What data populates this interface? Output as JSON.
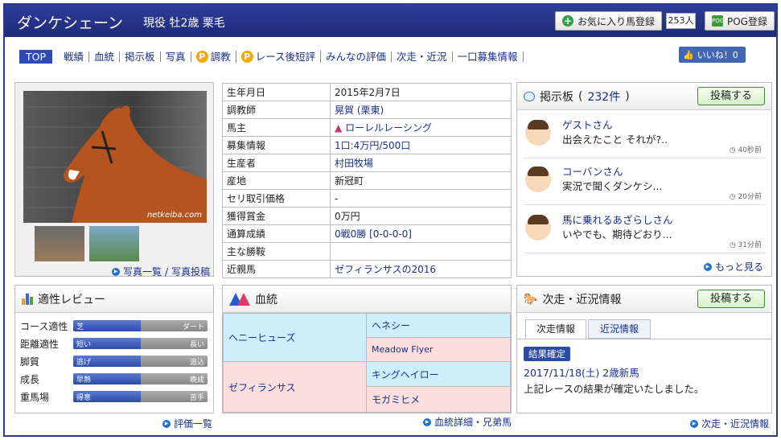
{
  "header": {
    "name": "ダンケシェーン",
    "status": "現役 牡2歳 栗毛",
    "fav_label": "お気に入り馬登録",
    "fav_count": "253人",
    "pog_label": "POG登録",
    "pog_icon": "POG"
  },
  "nav": {
    "top": "TOP",
    "items": [
      "戦績",
      "血統",
      "掲示板",
      "写真",
      "調教",
      "レース後短評",
      "みんなの評価",
      "次走・近況",
      "一口募集情報"
    ],
    "like": "いいね！0"
  },
  "photo": {
    "watermark": "netkeiba.com",
    "link1": "写真一覧",
    "link2": "写真投稿"
  },
  "profile": [
    {
      "k": "生年月日",
      "v": "2015年2月7日"
    },
    {
      "k": "調教師",
      "v": "晃賀 (栗東)"
    },
    {
      "k": "馬主",
      "v": "ローレルレーシング"
    },
    {
      "k": "募集情報",
      "v": "1口:4万円/500口"
    },
    {
      "k": "生産者",
      "v": "村田牧場"
    },
    {
      "k": "産地",
      "v": "新冠町"
    },
    {
      "k": "セリ取引価格",
      "v": "-"
    },
    {
      "k": "獲得賞金",
      "v": "0万円"
    },
    {
      "k": "通算成績",
      "v": "0戦0勝 [0-0-0-0]"
    },
    {
      "k": "主な勝鞍",
      "v": ""
    },
    {
      "k": "近親馬",
      "v": "ゼフィランサスの2016"
    }
  ],
  "bbs": {
    "title": "掲示板",
    "count": "232件",
    "post": "投稿する",
    "more": "もっと見る",
    "comments": [
      {
        "user": "ゲストさん",
        "text": "出会えたこと それが?..",
        "time": "40秒前"
      },
      {
        "user": "コーバンさん",
        "text": "実況で聞くダンケシ...",
        "time": "20分前"
      },
      {
        "user": "馬に乗れるあざらしさん",
        "text": "いやでも、期待どおり...",
        "time": "31分前"
      }
    ]
  },
  "aptitude": {
    "title": "適性レビュー",
    "link": "評価一覧",
    "rows": [
      {
        "label": "コース適性",
        "left": "芝",
        "right": "ダート",
        "level": 0.5
      },
      {
        "label": "距離適性",
        "left": "短い",
        "right": "長い",
        "level": 0.5
      },
      {
        "label": "脚質",
        "left": "逃げ",
        "right": "追込",
        "level": 0.5
      },
      {
        "label": "成長",
        "left": "早熟",
        "right": "晩成",
        "level": 0.5
      },
      {
        "label": "重馬場",
        "left": "得意",
        "right": "苦手",
        "level": 0.5
      }
    ]
  },
  "pedigree": {
    "title": "血統",
    "sire": "ヘニーヒューズ",
    "dam": "ゼフィランサス",
    "ss": "ヘネシー",
    "sd": "Meadow Flyer",
    "ds": "キングヘイロー",
    "dd": "モガミヒメ",
    "link": "血統詳細・兄弟馬"
  },
  "news": {
    "title": "次走・近況情報",
    "post": "投稿する",
    "tab1": "次走情報",
    "tab2": "近況情報",
    "badge": "結果確定",
    "race": "2017/11/18(土) 2歳新馬",
    "msg": "上記レースの結果が確定いたしました。",
    "link": "次走・近況情報"
  }
}
